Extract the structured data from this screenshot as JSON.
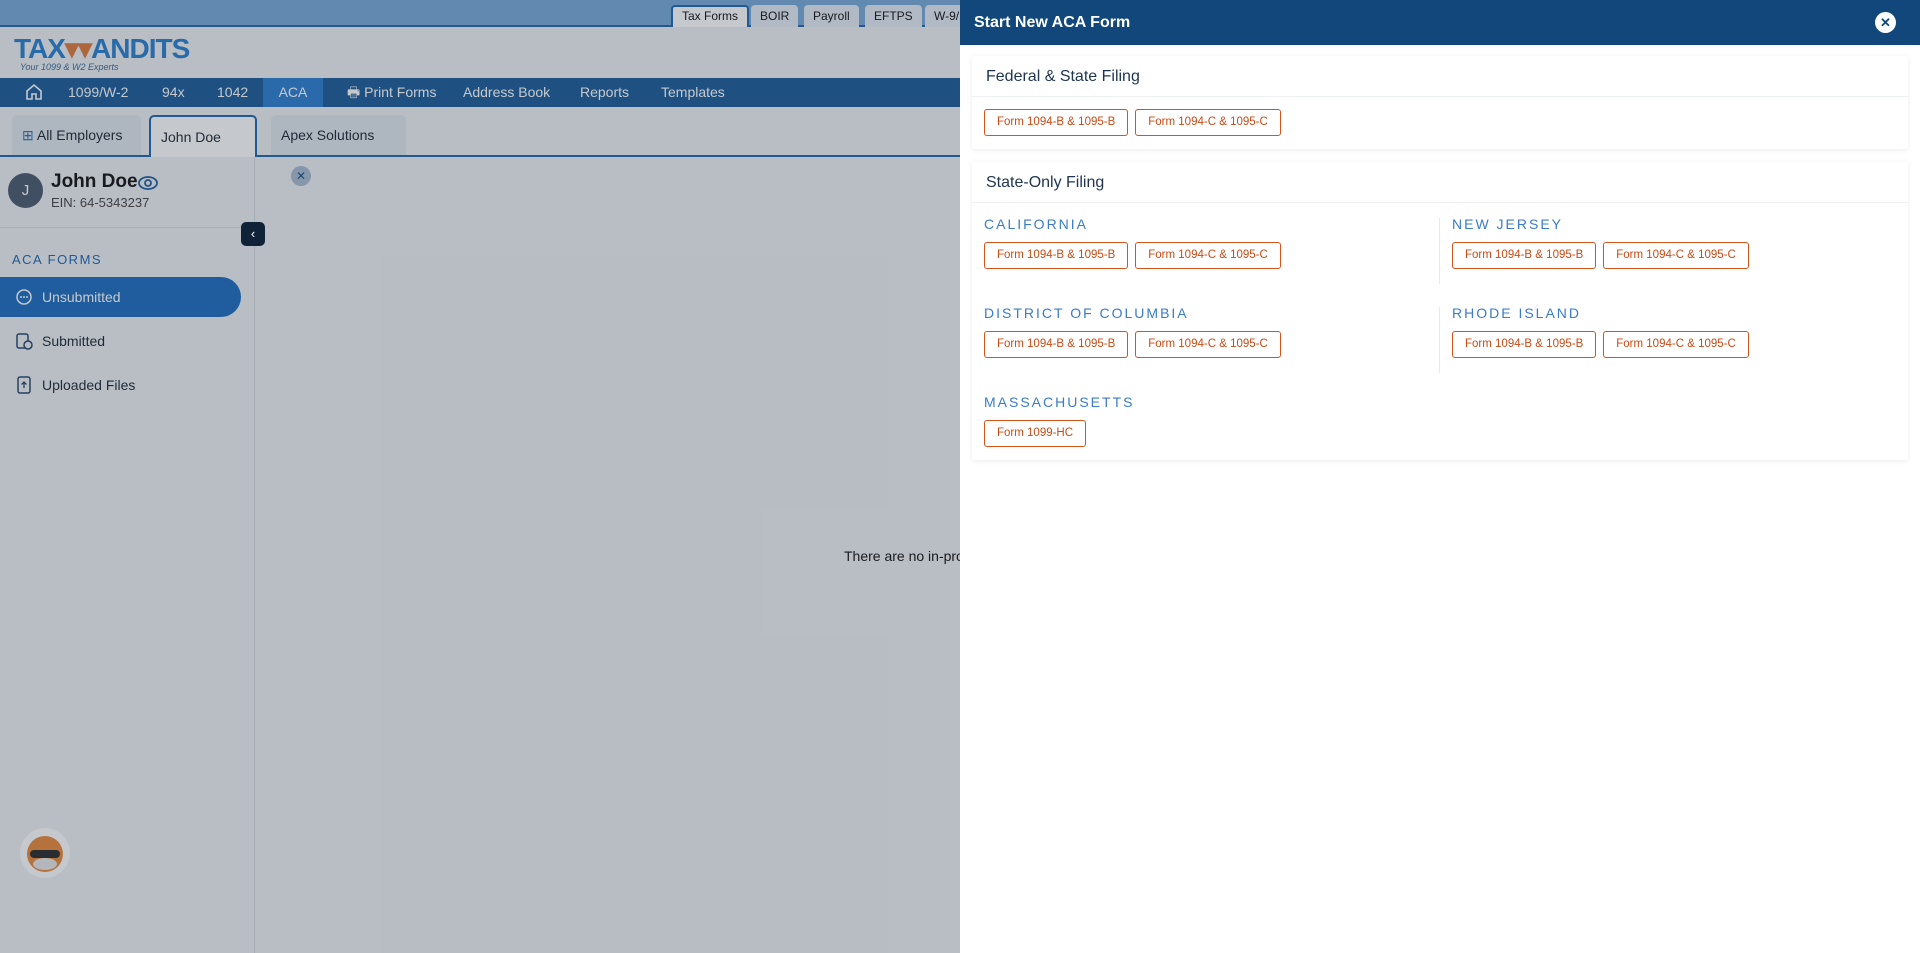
{
  "top_tabs": [
    "Tax Forms",
    "BOIR",
    "Payroll",
    "EFTPS",
    "W-9/"
  ],
  "logo": {
    "brand": "TAXBANDITS",
    "tagline": "Your 1099 & W2 Experts"
  },
  "nav": {
    "items": [
      "1099/W-2",
      "94x",
      "1042",
      "ACA",
      "Print Forms",
      "Address Book",
      "Reports",
      "Templates"
    ],
    "active": "ACA"
  },
  "employer_tabs": {
    "all": "All Employers",
    "tabs": [
      "John Doe",
      "Apex Solutions"
    ]
  },
  "employer": {
    "initial": "J",
    "name": "John Doe",
    "ein": "EIN: 64-5343237"
  },
  "sidebar": {
    "section": "ACA FORMS",
    "items": [
      "Unsubmitted",
      "Submitted",
      "Uploaded Files"
    ]
  },
  "main": {
    "empty_text": "There are no in-pro"
  },
  "drawer": {
    "title": "Start New ACA Form",
    "federal": {
      "title": "Federal & State Filing",
      "buttons": [
        "Form 1094-B & 1095-B",
        "Form 1094-C & 1095-C"
      ]
    },
    "state_only": {
      "title": "State-Only Filing",
      "states": [
        {
          "name": "CALIFORNIA",
          "buttons": [
            "Form 1094-B & 1095-B",
            "Form 1094-C & 1095-C"
          ]
        },
        {
          "name": "NEW JERSEY",
          "buttons": [
            "Form 1094-B & 1095-B",
            "Form 1094-C & 1095-C"
          ]
        },
        {
          "name": "DISTRICT OF COLUMBIA",
          "buttons": [
            "Form 1094-B & 1095-B",
            "Form 1094-C & 1095-C"
          ]
        },
        {
          "name": "RHODE ISLAND",
          "buttons": [
            "Form 1094-B & 1095-B",
            "Form 1094-C & 1095-C"
          ]
        },
        {
          "name": "MASSACHUSETTS",
          "buttons": [
            "Form 1099-HC"
          ]
        }
      ]
    }
  },
  "colors": {
    "nav": "#1b5c99",
    "accent": "#1c6dc0",
    "drawer_header": "#11477a",
    "form_button": "#d4541a"
  }
}
